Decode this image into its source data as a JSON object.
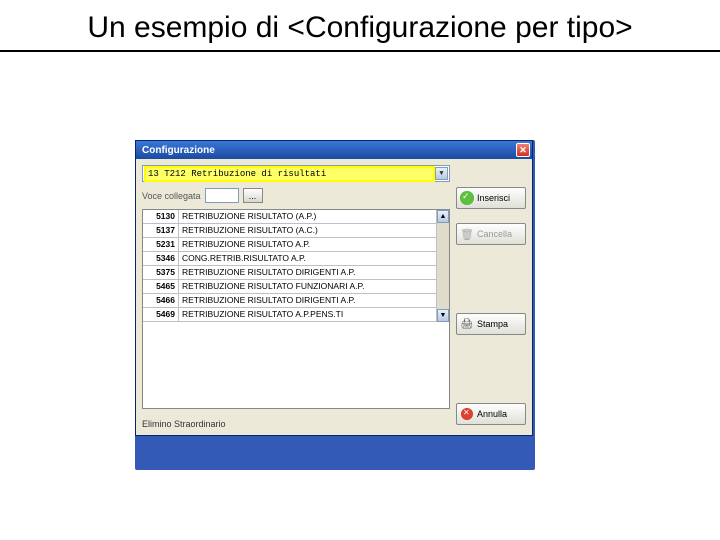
{
  "slide": {
    "title": "Un esempio di <Configurazione per tipo>"
  },
  "window": {
    "title": "Configurazione",
    "close_label": "✕"
  },
  "combo": {
    "selected": "13 T212 Retribuzione di risultati"
  },
  "voce": {
    "label": "Voce collegata",
    "value": "",
    "lookup_label": "..."
  },
  "table": {
    "rows": [
      {
        "code": "5130",
        "desc": "RETRIBUZIONE RISULTATO (A.P.)"
      },
      {
        "code": "5137",
        "desc": "RETRIBUZIONE RISULTATO (A.C.)"
      },
      {
        "code": "5231",
        "desc": "RETRIBUZIONE RISULTATO A.P."
      },
      {
        "code": "5346",
        "desc": "CONG.RETRIB.RISULTATO A.P."
      },
      {
        "code": "5375",
        "desc": "RETRIBUZIONE RISULTATO DIRIGENTI A.P."
      },
      {
        "code": "5465",
        "desc": "RETRIBUZIONE RISULTATO FUNZIONARI A.P."
      },
      {
        "code": "5466",
        "desc": "RETRIBUZIONE RISULTATO DIRIGENTI A.P."
      },
      {
        "code": "5469",
        "desc": "RETRIBUZIONE RISULTATO A.P.PENS.TI"
      }
    ]
  },
  "footer": {
    "label": "Elimino Straordinario"
  },
  "actions": {
    "insert": "Inserisci",
    "delete": "Cancella",
    "print": "Stampa",
    "cancel": "Annulla"
  }
}
